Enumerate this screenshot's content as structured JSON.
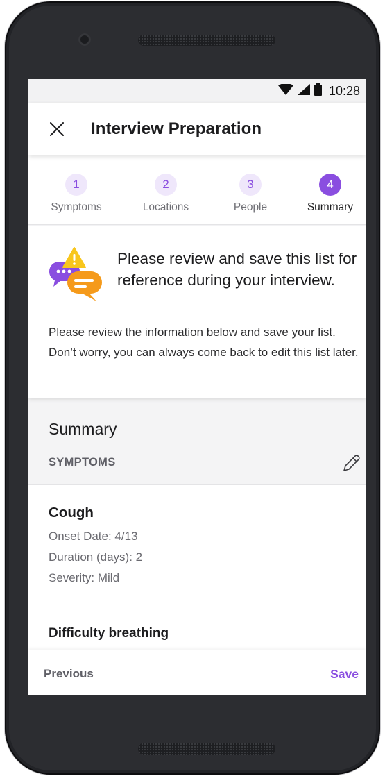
{
  "status_bar": {
    "time": "10:28",
    "icons": [
      "wifi-icon",
      "signal-icon",
      "battery-icon"
    ]
  },
  "app_bar": {
    "close_icon": "close-icon",
    "title": "Interview Preparation"
  },
  "stepper": {
    "current_step": 4,
    "steps": [
      {
        "number": "1",
        "label": "Symptoms"
      },
      {
        "number": "2",
        "label": "Locations"
      },
      {
        "number": "3",
        "label": "People"
      },
      {
        "number": "4",
        "label": "Summary"
      }
    ]
  },
  "intro": {
    "illustration": "chat-bubbles-warning-icon",
    "headline": "Please review and save this list for reference during your interview.",
    "body": "Please review the information below and save your list. Don’t worry, you can always come back to edit this list later."
  },
  "summary": {
    "title": "Summary",
    "section_label": "SYMPTOMS",
    "edit_icon": "pencil-icon",
    "symptoms": [
      {
        "name": "Cough",
        "details": [
          "Onset Date: 4/13",
          "Duration (days): 2",
          "Severity: Mild"
        ]
      },
      {
        "name": "Difficulty breathing",
        "details": []
      }
    ]
  },
  "footer": {
    "previous_label": "Previous",
    "save_label": "Save"
  },
  "colors": {
    "accent": "#8a4ee0",
    "accent_light": "#efe7fb",
    "illustration_orange": "#f59a1b",
    "illustration_yellow": "#f8c61c",
    "device_frame": "#222327"
  }
}
